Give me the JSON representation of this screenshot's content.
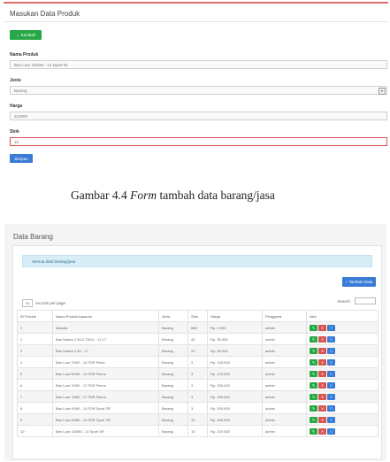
{
  "form": {
    "title": "Masukan Data Produk",
    "kembali_label": "Kembali",
    "kembali_icon": "back-arrow-icon",
    "nama_label": "Nama Produk",
    "nama_value": "Ban Luar 100/80 - 14 Sport 65",
    "jenis_label": "Jenis",
    "jenis_value": "Barang",
    "harga_label": "Harga",
    "harga_value": "210000",
    "stok_label": "Stok",
    "stok_value": "16",
    "simpan_label": "Simpan"
  },
  "captions": {
    "prefix": "Gambar 4.4 ",
    "emph": "Form",
    "suffix": " tambah data barang/jasa"
  },
  "list": {
    "title": "Data Barang",
    "alert_text": "Semua data barang/jasa",
    "add_label": "Tambah Data",
    "add_icon": "plus-icon",
    "length_value": "10",
    "length_text": "records per page",
    "search_label": "Search:",
    "columns": [
      "ID Produk",
      "Nama Produk/Layanan",
      "Jenis",
      "Stok",
      "Harga",
      "Pengguna",
      "Aksi"
    ],
    "rows": [
      [
        "1",
        "Motoba",
        "Barang",
        "888",
        "Rp. 4.500",
        "admin"
      ],
      [
        "2",
        "Ban Dalam 2.50-2.75/14 - 14 17",
        "Barang",
        "40",
        "Rp. 35.000",
        "admin"
      ],
      [
        "3",
        "Ban Dalam 2.50 - 17",
        "Barang",
        "20",
        "Rp. 35.000",
        "admin"
      ],
      [
        "4",
        "Ban Luar 70/90 - 14 FDR Flesh",
        "Barang",
        "3",
        "Rp. 145.000",
        "admin"
      ],
      [
        "5",
        "Ban Luar 80/90 - 14 FDR Flemo",
        "Barang",
        "3",
        "Rp. 175.000",
        "admin"
      ],
      [
        "6",
        "Ban Luar 70/90 - 17 FDR Flemo",
        "Barang",
        "3",
        "Rp. 155.000",
        "admin"
      ],
      [
        "7",
        "Ban Luar 70/80 - 17 FDR Flemo",
        "Barang",
        "3",
        "Rp. 165.000",
        "admin"
      ],
      [
        "8",
        "Ban Luar 90/90 - 14 FDR Sport ZR",
        "Barang",
        "3",
        "Rp. 193.000",
        "admin"
      ],
      [
        "9",
        "Ban Luar 80/80 - 14 FDR Sport XR",
        "Barang",
        "15",
        "Rp. 185.000",
        "admin"
      ],
      [
        "10",
        "Ban Luar 100/80 - 14 Sport XR",
        "Barang",
        "15",
        "Rp. 210.000",
        "admin"
      ]
    ],
    "action_icons": [
      "edit-icon",
      "delete-icon",
      "view-icon"
    ]
  },
  "colors": {
    "green": "#27a845",
    "red": "#d9534f",
    "blue": "#3a7bd5",
    "alert_bg": "#d9edf7"
  }
}
